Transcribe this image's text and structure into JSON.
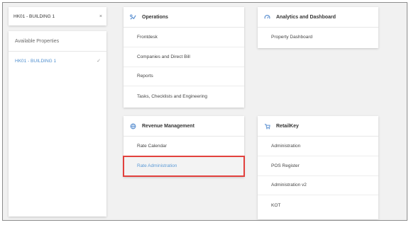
{
  "property_selector": {
    "value": "HK01 - BUILDING 1",
    "clear_glyph": "×"
  },
  "properties_panel": {
    "header": "Available Properties",
    "items": [
      {
        "label": "HK01 - BUILDING 1",
        "selected": true
      }
    ]
  },
  "modules": {
    "operations": {
      "title": "Operations",
      "icon": "operations-icon",
      "items": [
        "Frontdesk",
        "Companies and Direct Bill",
        "Reports",
        "Tasks, Checklists and Engineering"
      ]
    },
    "analytics": {
      "title": "Analytics and Dashboard",
      "icon": "dashboard-icon",
      "items": [
        "Property Dashboard"
      ]
    },
    "revenue": {
      "title": "Revenue Management",
      "icon": "revenue-icon",
      "items": [
        "Rate Calendar",
        "Rate Administration"
      ],
      "highlighted": "Rate Administration"
    },
    "retailkey": {
      "title": "RetailKey",
      "icon": "retail-icon",
      "items": [
        "Administration",
        "POS Register",
        "Administration v2",
        "KOT"
      ]
    }
  },
  "colors": {
    "accent": "#4f8fcf",
    "highlight_border": "#e2413d",
    "icon": "#5a8fd0"
  }
}
